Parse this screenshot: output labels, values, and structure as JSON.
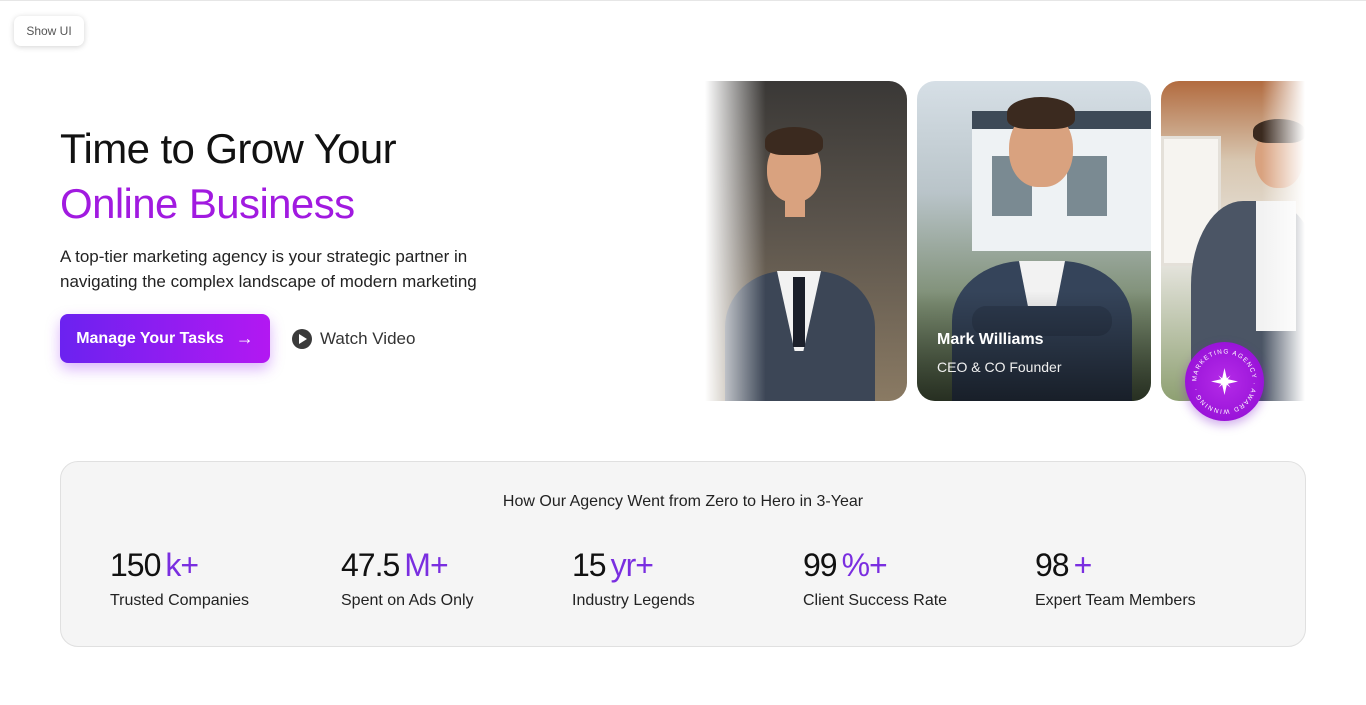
{
  "toolbar": {
    "show_ui": "Show UI"
  },
  "hero": {
    "title_line1": "Time to Grow Your",
    "title_line2": "Online Business",
    "description": "A top-tier marketing agency is your strategic partner in navigating the complex landscape of modern marketing",
    "cta_primary": "Manage Your Tasks",
    "cta_secondary": "Watch Video"
  },
  "team": {
    "featured_name": "Mark Williams",
    "featured_role": "CEO & CO Founder",
    "badge_text": "MARKETING AGENCY · AWARD WINNING ·"
  },
  "stats": {
    "title": "How Our Agency Went from Zero to Hero in 3-Year",
    "items": [
      {
        "number": "150",
        "suffix": "k+",
        "label": "Trusted Companies"
      },
      {
        "number": "47.5",
        "suffix": "M+",
        "label": "Spent on Ads Only"
      },
      {
        "number": "15",
        "suffix": "yr+",
        "label": "Industry Legends"
      },
      {
        "number": "99",
        "suffix": "%+",
        "label": "Client Success Rate"
      },
      {
        "number": "98",
        "suffix": "+",
        "label": "Expert Team Members"
      }
    ]
  },
  "colors": {
    "accent": "#a11ae0",
    "stat_suffix": "#7a2ee0",
    "cta_gradient_start": "#6b22f0",
    "cta_gradient_end": "#b318f2"
  },
  "icons": {
    "cta_arrow": "arrow-right-icon",
    "play": "play-icon",
    "badge_star": "sparkle-icon"
  }
}
